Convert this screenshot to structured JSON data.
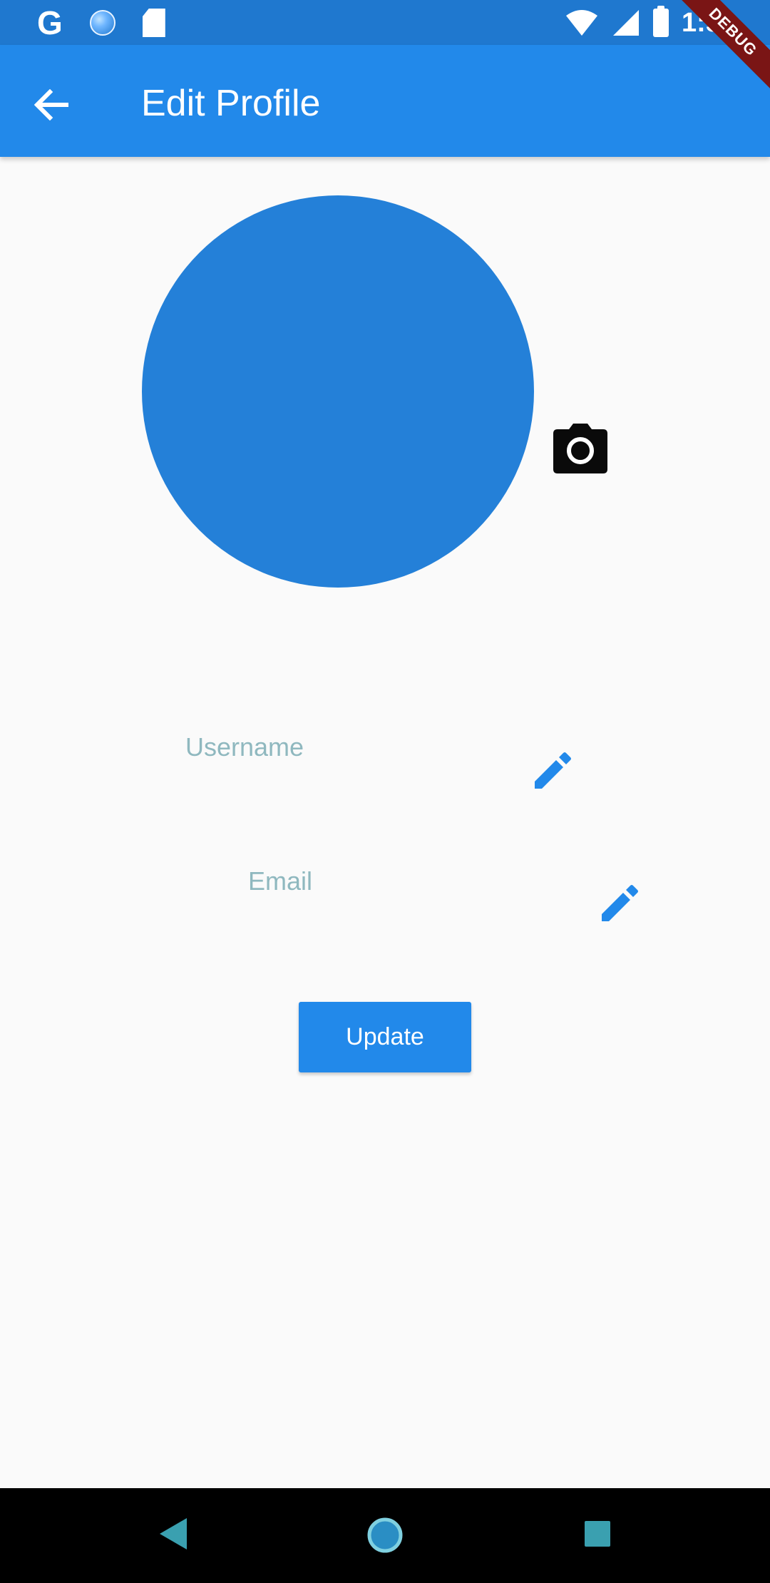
{
  "status_bar": {
    "left_icons": [
      "google-g-icon",
      "assistant-dot-icon",
      "sd-card-icon"
    ],
    "g_glyph": "G",
    "time": "1:50",
    "right_icons": [
      "wifi-icon",
      "signal-icon",
      "battery-icon"
    ]
  },
  "debug_banner": "DEBUG",
  "app_bar": {
    "title": "Edit Profile",
    "back_icon": "arrow-back-icon"
  },
  "profile": {
    "avatar_color": "#2480d8",
    "camera_icon": "camera-icon"
  },
  "form": {
    "username_label": "Username",
    "email_label": "Email",
    "edit_icon": "pencil-icon",
    "update_label": "Update"
  },
  "colors": {
    "primary": "#2289ea",
    "status_bar": "#1f78cf",
    "label": "#8fb8bf",
    "background": "#fafafa"
  },
  "nav_bar": {
    "icons": [
      "nav-back-icon",
      "nav-home-icon",
      "nav-recents-icon"
    ]
  }
}
